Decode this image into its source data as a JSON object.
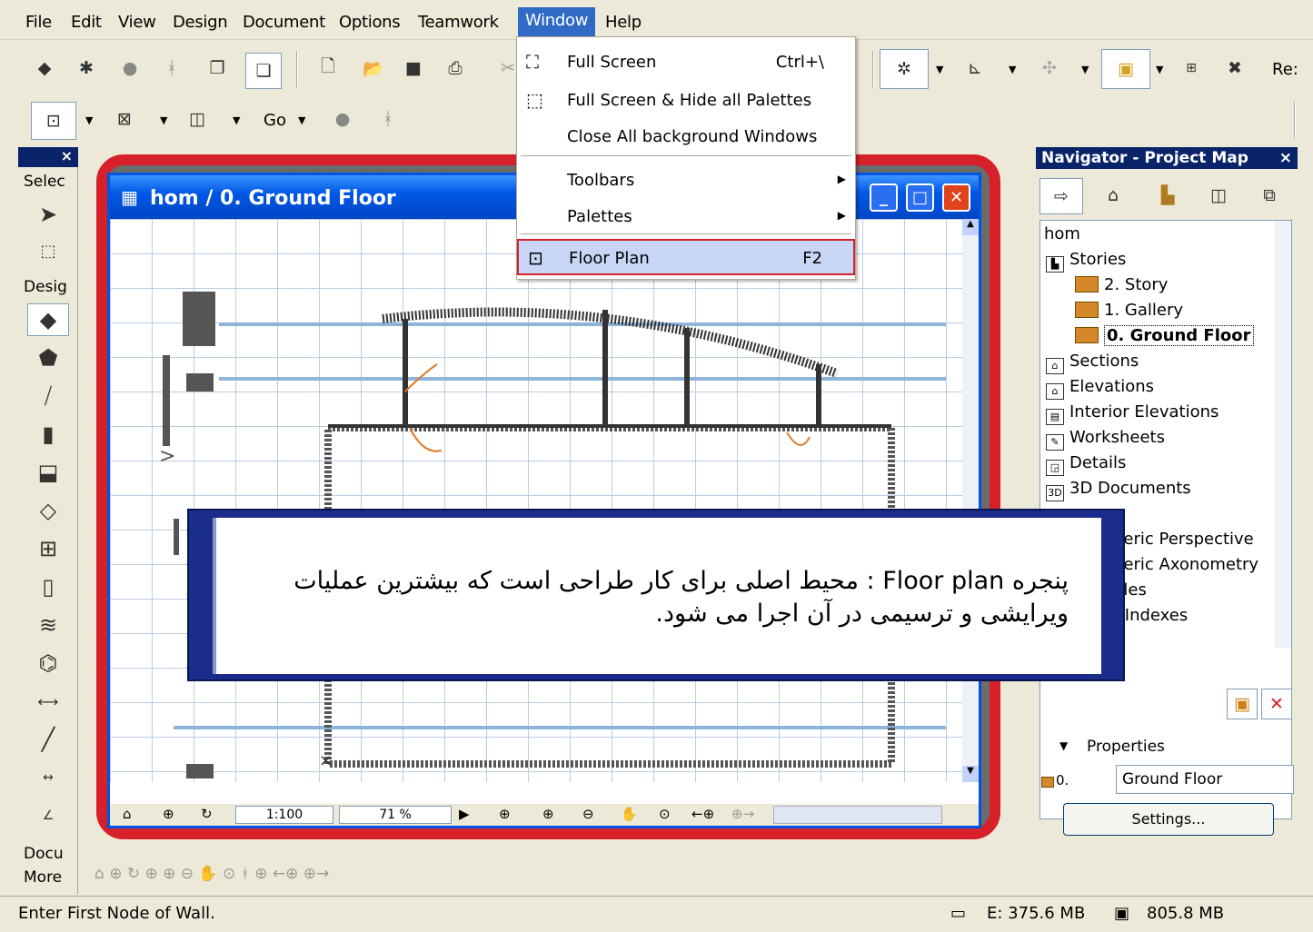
{
  "menubar": {
    "items": [
      "File",
      "Edit",
      "View",
      "Design",
      "Document",
      "Options",
      "Teamwork",
      "Window",
      "Help"
    ],
    "active": "Window",
    "truncated_right": "Re:"
  },
  "toolbar2": {
    "go_label": "Go"
  },
  "toolbox": {
    "close_glyph": "×",
    "select_label": "Selec",
    "design_label": "Desig",
    "document_label": "Docu",
    "more_label": "More"
  },
  "document_window": {
    "title": "hom / 0. Ground Floor",
    "scale": "1:100",
    "zoom": "71 %"
  },
  "window_menu": {
    "items": [
      {
        "label": "Full Screen",
        "shortcut": "Ctrl+\\",
        "icon": "fullscreen-icon"
      },
      {
        "label": "Full Screen & Hide all Palettes",
        "shortcut": "",
        "icon": "fullscreen-hide-icon"
      },
      {
        "label": "Close All background Windows",
        "shortcut": "",
        "icon": ""
      },
      {
        "label": "Toolbars",
        "shortcut": "",
        "submenu": true
      },
      {
        "label": "Palettes",
        "shortcut": "",
        "submenu": true
      },
      {
        "label": "Floor Plan",
        "shortcut": "F2",
        "icon": "floorplan-icon",
        "highlighted": true
      }
    ]
  },
  "navigator": {
    "title": "Navigator - Project Map",
    "close_glyph": "×",
    "tree": {
      "root": "hom",
      "stories_label": "Stories",
      "stories": [
        "2. Story",
        "1. Gallery",
        "0. Ground Floor"
      ],
      "selected_story": "0. Ground Floor",
      "sections": [
        "Sections",
        "Elevations",
        "Interior Elevations",
        "Worksheets",
        "Details",
        "3D Documents"
      ],
      "partial_items": [
        "neric Perspective",
        "neric Axonometry",
        "ules",
        "t Indexes"
      ]
    },
    "properties_label": "Properties",
    "story_number": "0.",
    "story_name": "Ground Floor",
    "settings_button": "Settings..."
  },
  "caption": {
    "line1": "پنجره Floor plan : محیط اصلی برای کار طراحی است که بیشترین عملیات",
    "line2": "ویرایشی و ترسیمی در آن اجرا می شود."
  },
  "statusbar": {
    "message": "Enter First Node of Wall.",
    "disk": "E: 375.6 MB",
    "memory": "805.8 MB"
  },
  "colors": {
    "menu_highlight": "#316ac5",
    "title_bar_blue": "#0058e6",
    "frame_red": "#d6202a",
    "caption_navy": "#1b2d8a"
  }
}
